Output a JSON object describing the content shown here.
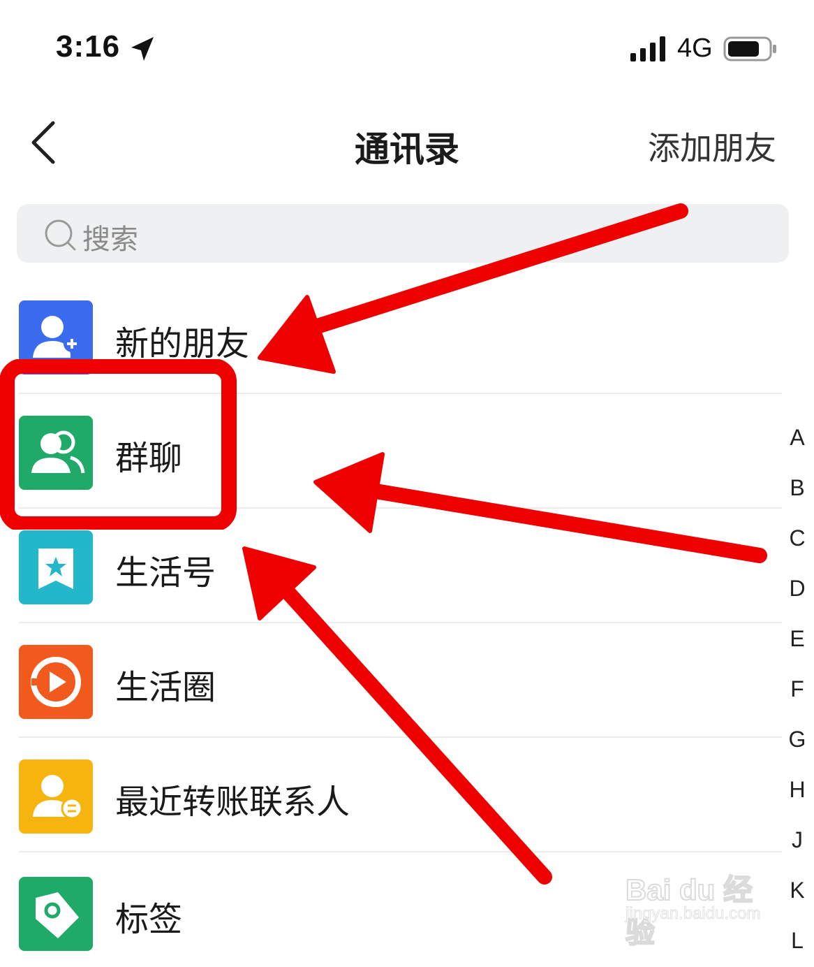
{
  "status_bar": {
    "time": "3:16",
    "network": "4G"
  },
  "nav": {
    "title": "通讯录",
    "action": "添加朋友"
  },
  "search": {
    "placeholder": "搜索"
  },
  "list": {
    "items": [
      {
        "label": "新的朋友",
        "icon": "new-friend-icon",
        "color": "#3b6cf0"
      },
      {
        "label": "群聊",
        "icon": "group-chat-icon",
        "color": "#1faa6a"
      },
      {
        "label": "生活号",
        "icon": "life-account-icon",
        "color": "#22b7c9"
      },
      {
        "label": "生活圈",
        "icon": "life-circle-icon",
        "color": "#f25a1d"
      },
      {
        "label": "最近转账联系人",
        "icon": "recent-transfer-contacts-icon",
        "color": "#f5b50e"
      },
      {
        "label": "标签",
        "icon": "tag-icon",
        "color": "#1faa6a"
      }
    ]
  },
  "index_letters": [
    "A",
    "B",
    "C",
    "D",
    "E",
    "F",
    "G",
    "H",
    "J",
    "K",
    "L"
  ],
  "annotation": {
    "color": "#ee0000"
  },
  "watermark": {
    "main": "Bai du 经验",
    "sub": "jingyan.baidu.com"
  }
}
